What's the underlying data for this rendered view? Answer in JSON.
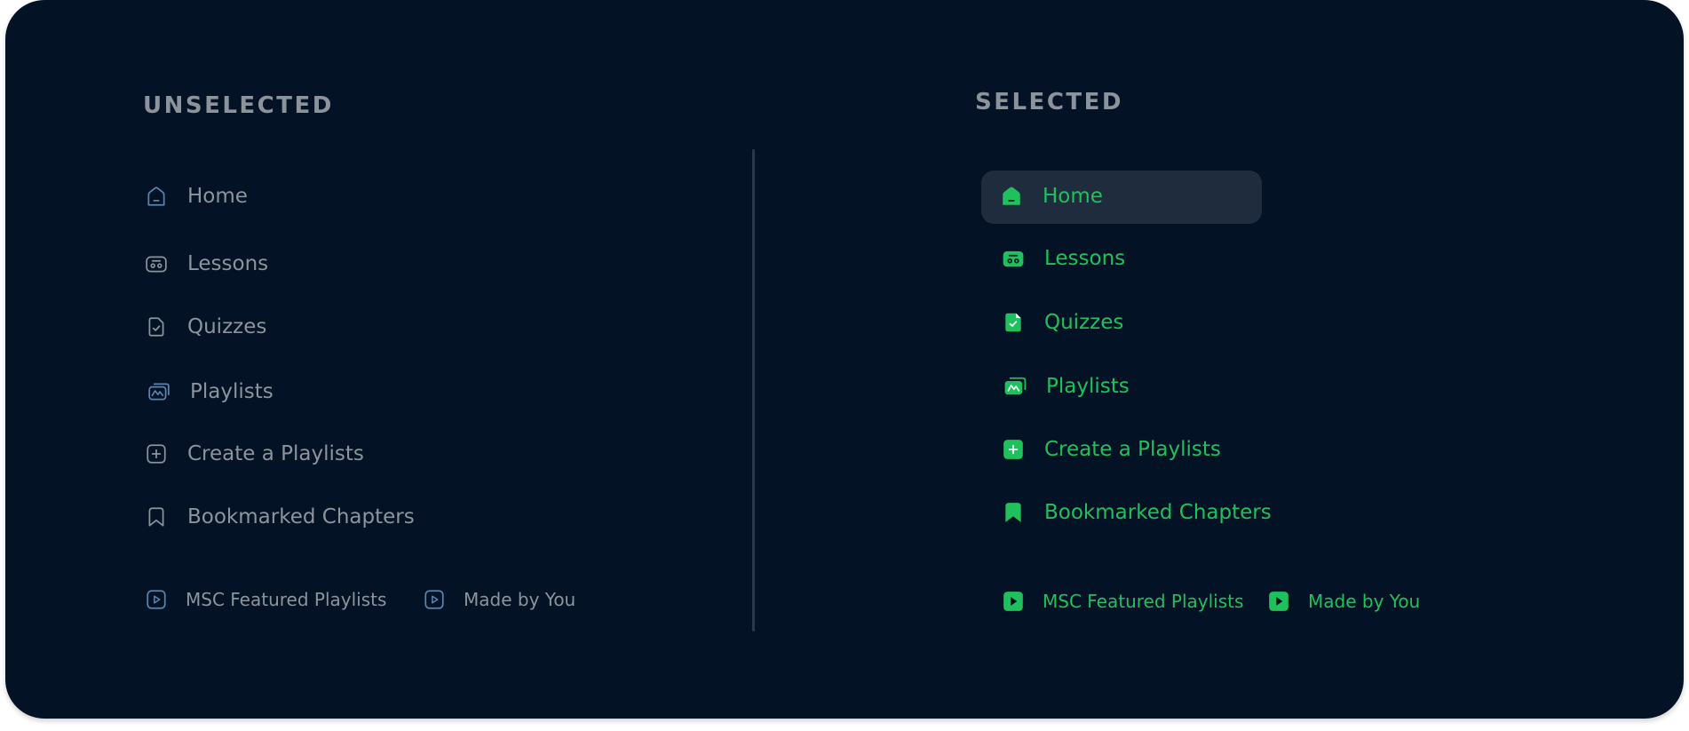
{
  "colors": {
    "background": "#031225",
    "unselected_text": "#8c949c",
    "unselected_icon": "#5a84ae",
    "selected_accent": "#20c05c",
    "selected_highlight": "#1f2c3d",
    "divider": "#2c3a48"
  },
  "unselected": {
    "heading": "UNSELECTED",
    "items": [
      {
        "label": "Home",
        "icon": "home-icon"
      },
      {
        "label": "Lessons",
        "icon": "lessons-icon"
      },
      {
        "label": "Quizzes",
        "icon": "quiz-icon"
      },
      {
        "label": "Playlists",
        "icon": "playlists-icon"
      },
      {
        "label": "Create a Playlists",
        "icon": "plus-icon"
      },
      {
        "label": "Bookmarked Chapters",
        "icon": "bookmark-icon"
      }
    ],
    "sub_items": [
      {
        "label": "MSC Featured Playlists",
        "icon": "play-icon"
      },
      {
        "label": "Made by You",
        "icon": "play-icon"
      }
    ]
  },
  "selected": {
    "heading": "SELECTED",
    "items": [
      {
        "label": "Home",
        "icon": "home-icon",
        "active": true
      },
      {
        "label": "Lessons",
        "icon": "lessons-icon"
      },
      {
        "label": "Quizzes",
        "icon": "quiz-icon"
      },
      {
        "label": "Playlists",
        "icon": "playlists-icon"
      },
      {
        "label": "Create a Playlists",
        "icon": "plus-icon"
      },
      {
        "label": "Bookmarked Chapters",
        "icon": "bookmark-icon"
      }
    ],
    "sub_items": [
      {
        "label": "MSC Featured Playlists",
        "icon": "play-icon"
      },
      {
        "label": "Made by You",
        "icon": "play-icon"
      }
    ]
  }
}
